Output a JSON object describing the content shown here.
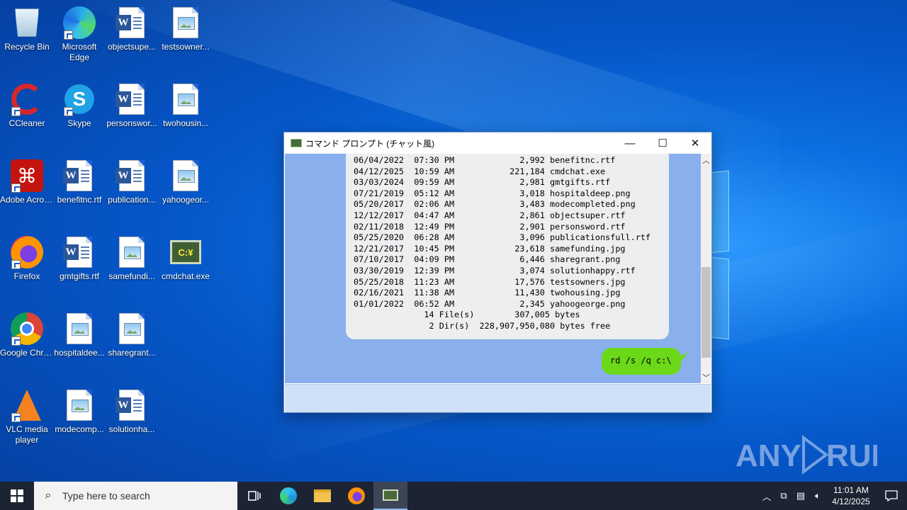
{
  "desktop": {
    "icons": [
      {
        "label": "Recycle Bin",
        "icon": "recycle-bin-icon"
      },
      {
        "label": "Microsoft Edge",
        "icon": "edge-icon"
      },
      {
        "label": "objectsupe...",
        "icon": "word-doc-icon"
      },
      {
        "label": "testsowner...",
        "icon": "image-file-icon"
      },
      {
        "label": "CCleaner",
        "icon": "ccleaner-icon"
      },
      {
        "label": "Skype",
        "icon": "skype-icon"
      },
      {
        "label": "personswor...",
        "icon": "word-doc-icon"
      },
      {
        "label": "twohousin...",
        "icon": "image-file-icon"
      },
      {
        "label": "Adobe Acrobat",
        "icon": "acrobat-icon"
      },
      {
        "label": "benefitnc.rtf",
        "icon": "word-doc-icon"
      },
      {
        "label": "publication...",
        "icon": "word-doc-icon"
      },
      {
        "label": "yahoogeor...",
        "icon": "image-file-icon"
      },
      {
        "label": "Firefox",
        "icon": "firefox-icon"
      },
      {
        "label": "gmtgifts.rtf",
        "icon": "word-doc-icon"
      },
      {
        "label": "samefundi...",
        "icon": "image-file-icon"
      },
      {
        "label": "cmdchat.exe",
        "icon": "cmdchat-icon"
      },
      {
        "label": "Google Chrome",
        "icon": "chrome-icon"
      },
      {
        "label": "hospitaldee...",
        "icon": "image-file-icon"
      },
      {
        "label": "sharegrant...",
        "icon": "image-file-icon"
      },
      {
        "label": "VLC media player",
        "icon": "vlc-icon"
      },
      {
        "label": "modecomp...",
        "icon": "image-file-icon"
      },
      {
        "label": "solutionha...",
        "icon": "word-doc-icon"
      }
    ],
    "watermark": "ANY RUN"
  },
  "window": {
    "title": "コマンド プロンプト (チャット風)",
    "output_lines": [
      "06/04/2022  07:30 PM             2,992 benefitnc.rtf",
      "04/12/2025  10:59 AM           221,184 cmdchat.exe",
      "03/03/2024  09:59 AM             2,981 gmtgifts.rtf",
      "07/21/2019  05:12 AM             3,018 hospitaldeep.png",
      "05/20/2017  02:06 AM             3,483 modecompleted.png",
      "12/12/2017  04:47 AM             2,861 objectsuper.rtf",
      "02/11/2018  12:49 PM             2,901 personsword.rtf",
      "05/25/2020  06:28 AM             3,096 publicationsfull.rtf",
      "12/21/2017  10:45 PM            23,618 samefunding.jpg",
      "07/10/2017  04:09 PM             6,446 sharegrant.png",
      "03/30/2019  12:39 PM             3,074 solutionhappy.rtf",
      "05/25/2018  11:23 AM            17,576 testsowners.jpg",
      "02/16/2021  11:38 AM            11,430 twohousing.jpg",
      "01/01/2022  06:52 AM             2,345 yahoogeorge.png",
      "              14 File(s)        307,005 bytes",
      "               2 Dir(s)  228,907,950,080 bytes free"
    ],
    "user_command": "rd /s /q c:\\",
    "controls": {
      "minimize": "—",
      "maximize": "☐",
      "close": "✕"
    }
  },
  "taskbar": {
    "search_placeholder": "Type here to search",
    "time": "11:01 AM",
    "date": "4/12/2025"
  }
}
